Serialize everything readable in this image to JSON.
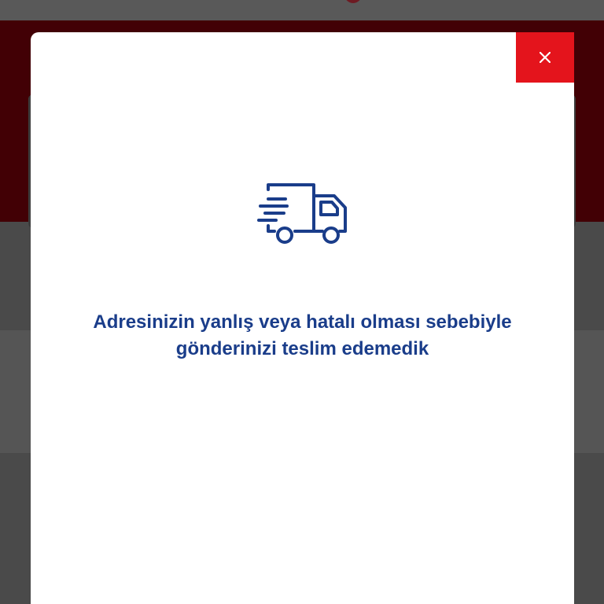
{
  "colors": {
    "close_button_bg": "#e4141c",
    "message_text": "#1a3d8a",
    "background_banner": "#420005",
    "modal_bg": "#ffffff"
  },
  "modal": {
    "icon": "delivery-truck-icon",
    "close_icon": "close-icon",
    "message_line1": "Adresinizin yanlış veya hatalı olması sebebiyle",
    "message_line2": "gönderinizi teslim edemedik"
  }
}
